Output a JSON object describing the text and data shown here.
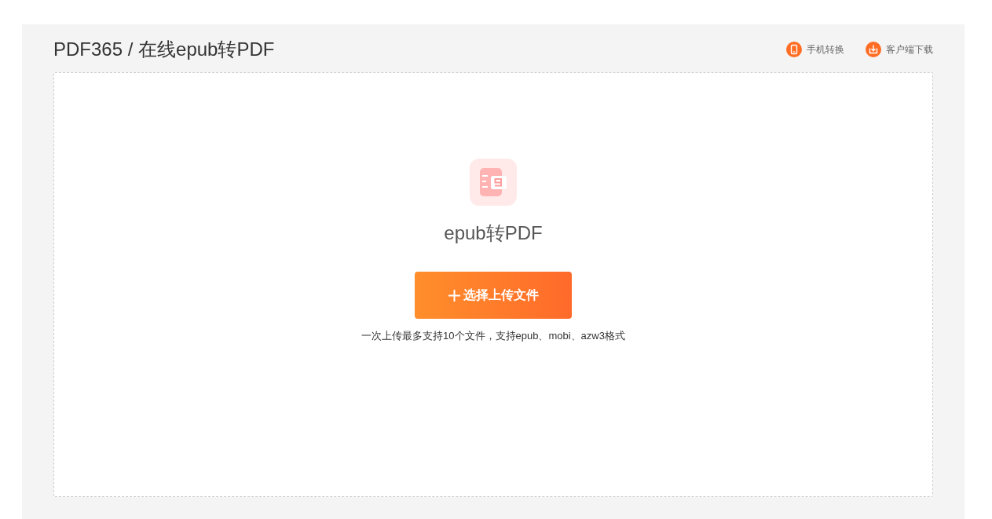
{
  "header": {
    "breadcrumb": "PDF365 / 在线epub转PDF",
    "links": [
      {
        "label": "手机转换",
        "kind": "mobile"
      },
      {
        "label": "客户端下载",
        "kind": "download"
      }
    ]
  },
  "upload": {
    "title": "epub转PDF",
    "button": "选择上传文件",
    "hint": "一次上传最多支持10个文件，支持epub、mobi、azw3格式"
  }
}
